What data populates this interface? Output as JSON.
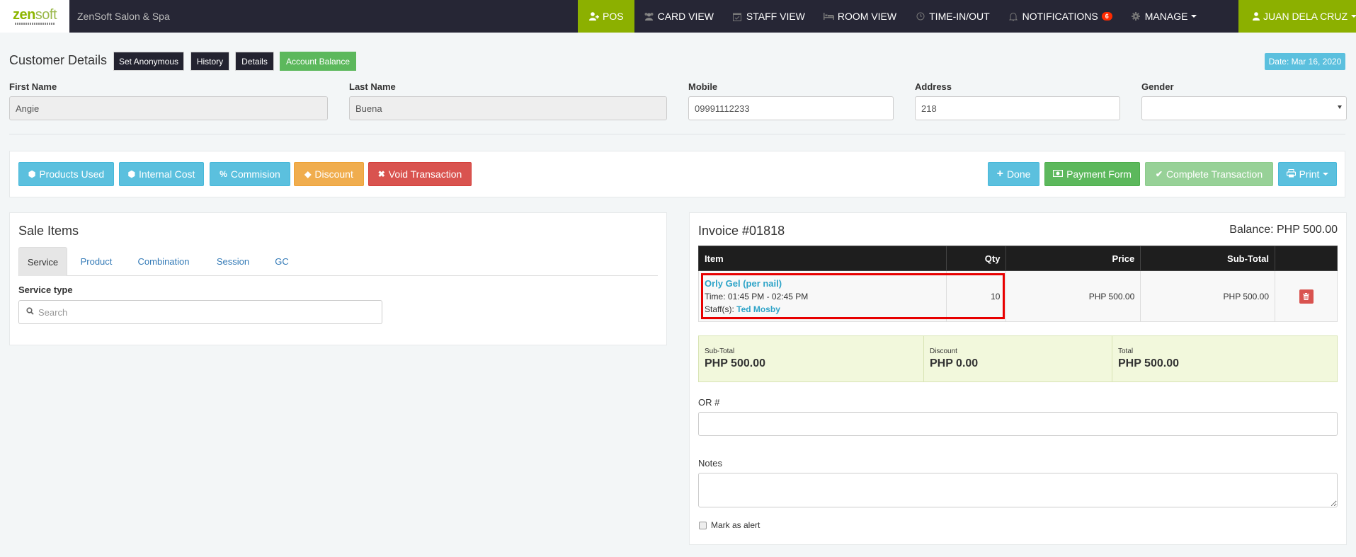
{
  "navbar": {
    "logo_main": "zen",
    "logo_accent": "soft",
    "brand": "ZenSoft Salon & Spa",
    "items": [
      {
        "label": "POS",
        "icon": "user-plus-icon",
        "active": true
      },
      {
        "label": "CARD VIEW",
        "icon": "users-icon"
      },
      {
        "label": "STAFF VIEW",
        "icon": "calendar-check-icon"
      },
      {
        "label": "ROOM VIEW",
        "icon": "bed-icon"
      },
      {
        "label": "TIME-IN/OUT",
        "icon": "clock-icon"
      },
      {
        "label": "NOTIFICATIONS",
        "icon": "bell-icon",
        "badge": "6"
      },
      {
        "label": "MANAGE",
        "icon": "gear-icon",
        "dropdown": true
      }
    ],
    "user": {
      "label": "JUAN DELA CRUZ",
      "icon": "user-icon"
    }
  },
  "customer": {
    "title": "Customer Details",
    "buttons": {
      "set_anonymous": "Set Anonymous",
      "history": "History",
      "details": "Details",
      "account_balance": "Account Balance"
    },
    "date": "Date: Mar 16, 2020",
    "fields": {
      "first_name": {
        "label": "First Name",
        "value": "Angie"
      },
      "last_name": {
        "label": "Last Name",
        "value": "Buena"
      },
      "mobile": {
        "label": "Mobile",
        "value": "09991112233"
      },
      "address": {
        "label": "Address",
        "value": "218"
      },
      "gender": {
        "label": "Gender",
        "value": ""
      }
    }
  },
  "actions": {
    "products_used": "Products Used",
    "internal_cost": "Internal Cost",
    "commision": "Commision",
    "discount": "Discount",
    "void_transaction": "Void Transaction",
    "done": "Done",
    "payment_form": "Payment Form",
    "complete_transaction": "Complete Transaction",
    "print": "Print"
  },
  "sale_items": {
    "title": "Sale Items",
    "tabs": [
      "Service",
      "Product",
      "Combination",
      "Session",
      "GC"
    ],
    "active_tab": "Service",
    "service_type_label": "Service type",
    "search_placeholder": "Search"
  },
  "invoice": {
    "title": "Invoice #01818",
    "balance": "Balance: PHP 500.00",
    "columns": [
      "Item",
      "Qty",
      "Price",
      "Sub-Total",
      ""
    ],
    "rows": [
      {
        "item": "Orly Gel (per nail)",
        "time": "Time: 01:45 PM - 02:45 PM",
        "staff_label": "Staff(s):",
        "staff": "Ted Mosby",
        "qty": "10",
        "price": "PHP 500.00",
        "subtotal": "PHP 500.00"
      }
    ],
    "totals": {
      "subtotal_label": "Sub-Total",
      "subtotal": "PHP 500.00",
      "discount_label": "Discount",
      "discount": "PHP 0.00",
      "total_label": "Total",
      "total": "PHP 500.00"
    },
    "or_label": "OR #",
    "or_value": "",
    "notes_label": "Notes",
    "notes_value": "",
    "mark_alert_label": "Mark as alert",
    "mark_alert_checked": false
  },
  "colors": {
    "navbar_bg": "#262635",
    "accent_green": "#8cb000",
    "info": "#5bc0de",
    "success": "#5cb85c",
    "warning": "#f0ad4e",
    "danger": "#d9534f",
    "highlight_border": "#e80000"
  }
}
